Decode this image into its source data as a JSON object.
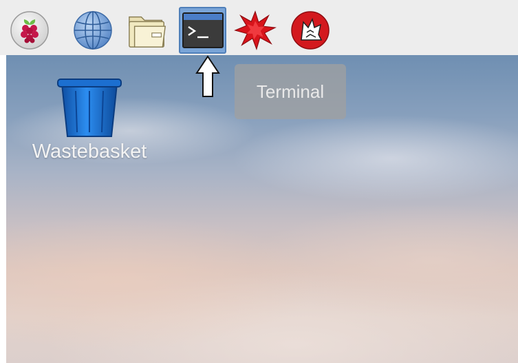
{
  "panel": {
    "launchers": [
      {
        "name": "raspberry-menu",
        "icon": "raspberry-icon"
      },
      {
        "name": "web-browser",
        "icon": "globe-icon"
      },
      {
        "name": "file-manager",
        "icon": "folder-icon"
      },
      {
        "name": "terminal",
        "icon": "terminal-icon",
        "active": true
      },
      {
        "name": "mathematica",
        "icon": "mathematica-icon"
      },
      {
        "name": "wolfram",
        "icon": "wolfram-icon"
      }
    ]
  },
  "tooltip": {
    "text": "Terminal"
  },
  "desktop": {
    "icons": [
      {
        "label": "Wastebasket",
        "icon": "trash-icon"
      }
    ]
  },
  "colors": {
    "panel_bg": "#ededed",
    "terminal_highlight": "#7aa5d8",
    "trash_blue": "#1a6fd1",
    "tooltip_bg": "#a0a0a0"
  }
}
